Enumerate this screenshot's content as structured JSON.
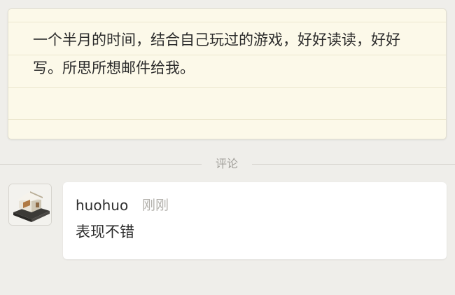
{
  "note": {
    "text": "一个半月的时间，结合自己玩过的游戏，好好读读，好好写。所思所想邮件给我。"
  },
  "comments_section": {
    "label": "评论"
  },
  "comment": {
    "author": "huohuo",
    "time": "刚刚",
    "text": "表现不错",
    "avatar_icon": "house-model-icon"
  }
}
